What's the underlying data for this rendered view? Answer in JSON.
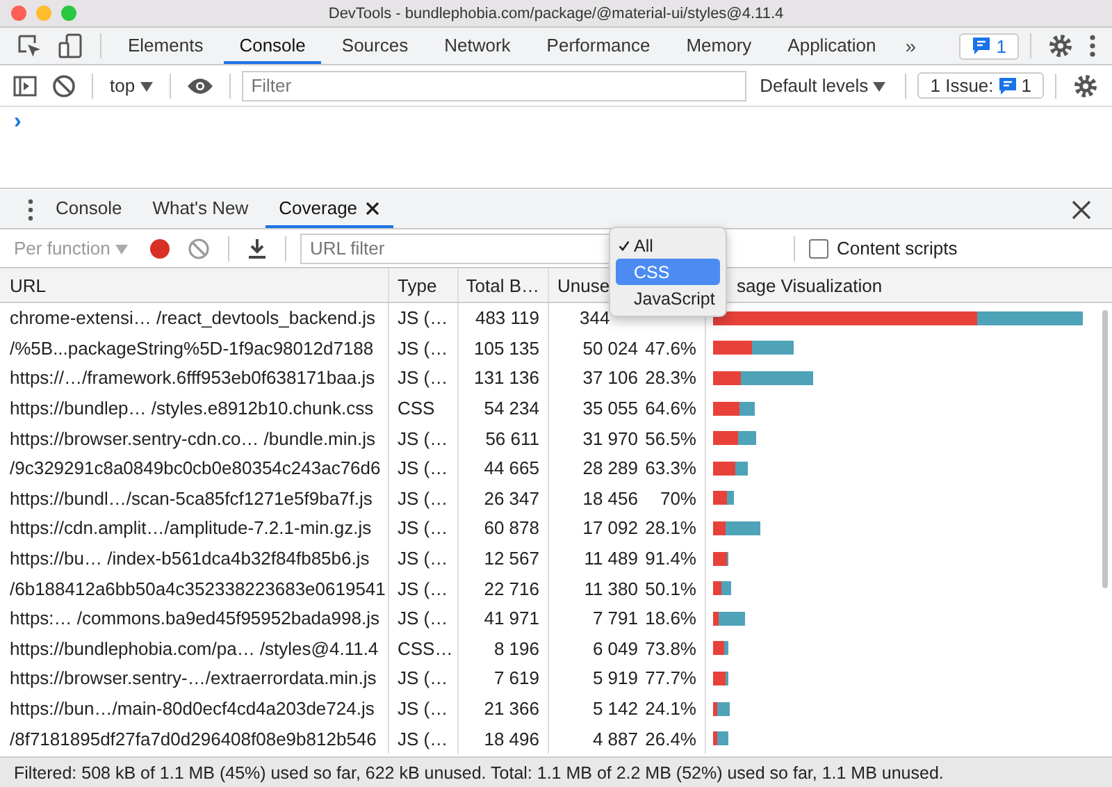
{
  "window": {
    "title": "DevTools - bundlephobia.com/package/@material-ui/styles@4.11.4"
  },
  "main_tabs": [
    {
      "label": "Elements",
      "selected": false
    },
    {
      "label": "Console",
      "selected": true
    },
    {
      "label": "Sources",
      "selected": false
    },
    {
      "label": "Network",
      "selected": false
    },
    {
      "label": "Performance",
      "selected": false
    },
    {
      "label": "Memory",
      "selected": false
    },
    {
      "label": "Application",
      "selected": false
    }
  ],
  "more_tabs": "»",
  "messages_badge": "1",
  "console_toolbar": {
    "context": "top",
    "filter_placeholder": "Filter",
    "levels": "Default levels",
    "issues_label": "1 Issue:",
    "issues_count": "1"
  },
  "prompt": "›",
  "drawer_tabs": [
    {
      "label": "Console",
      "selected": false,
      "closable": false
    },
    {
      "label": "What's New",
      "selected": false,
      "closable": false
    },
    {
      "label": "Coverage",
      "selected": true,
      "closable": true
    }
  ],
  "coverage_toolbar": {
    "mode": "Per function",
    "recording": true,
    "url_filter_placeholder": "URL filter",
    "content_scripts": {
      "label": "Content scripts",
      "checked": false
    }
  },
  "type_menu": [
    {
      "label": "All",
      "checked": true,
      "selected": false
    },
    {
      "label": "CSS",
      "checked": false,
      "selected": true
    },
    {
      "label": "JavaScript",
      "checked": false,
      "selected": false
    }
  ],
  "table": {
    "columns": [
      "URL",
      "Type",
      "Total B…",
      "Unuse",
      "sage Visualization"
    ],
    "rows": [
      {
        "url": "chrome-extensi…  /react_devtools_backend.js",
        "type": "JS (…",
        "total": "483 119",
        "unused": "344",
        "level": 0.713
      },
      {
        "url": "/%5B...packageString%5D-1f9ac98012d7188",
        "type": "JS (…",
        "total": "105 135",
        "unused": "50 024",
        "percent": "47.6%",
        "level": 0.476
      },
      {
        "url": "https://…/framework.6fff953eb0f638171baa.js",
        "type": "JS (…",
        "total": "131 136",
        "unused": "37 106",
        "percent": "28.3%",
        "level": 0.283
      },
      {
        "url": "https://bundlep…  /styles.e8912b10.chunk.css",
        "type": "CSS",
        "total": "54 234",
        "unused": "35 055",
        "percent": "64.6%",
        "level": 0.646
      },
      {
        "url": "https://browser.sentry-cdn.co… /bundle.min.js",
        "type": "JS (…",
        "total": "56 611",
        "unused": "31 970",
        "percent": "56.5%",
        "level": 0.565
      },
      {
        "url": "/9c329291c8a0849bc0cb0e80354c243ac76d6",
        "type": "JS (…",
        "total": "44 665",
        "unused": "28 289",
        "percent": "63.3%",
        "level": 0.633
      },
      {
        "url": "https://bundl…/scan-5ca85fcf1271e5f9ba7f.js",
        "type": "JS (…",
        "total": "26 347",
        "unused": "18 456",
        "percent": "70%",
        "level": 0.7
      },
      {
        "url": "https://cdn.amplit…/amplitude-7.2.1-min.gz.js",
        "type": "JS (…",
        "total": "60 878",
        "unused": "17 092",
        "percent": "28.1%",
        "level": 0.281
      },
      {
        "url": "https://bu…  /index-b561dca4b32f84fb85b6.js",
        "type": "JS (…",
        "total": "12 567",
        "unused": "11 489",
        "percent": "91.4%",
        "level": 0.914
      },
      {
        "url": "/6b188412a6bb50a4c352338223683e0619541",
        "type": "JS (…",
        "total": "22 716",
        "unused": "11 380",
        "percent": "50.1%",
        "level": 0.501
      },
      {
        "url": "https:… /commons.ba9ed45f95952bada998.js",
        "type": "JS (…",
        "total": "41 971",
        "unused": "7 791",
        "percent": "18.6%",
        "level": 0.186
      },
      {
        "url": "https://bundlephobia.com/pa… /styles@4.11.4",
        "type": "CSS…",
        "total": "8 196",
        "unused": "6 049",
        "percent": "73.8%",
        "level": 0.738
      },
      {
        "url": "https://browser.sentry-…/extraerrordata.min.js",
        "type": "JS (…",
        "total": "7 619",
        "unused": "5 919",
        "percent": "77.7%",
        "level": 0.777
      },
      {
        "url": "https://bun…/main-80d0ecf4cd4a203de724.js",
        "type": "JS (…",
        "total": "21 366",
        "unused": "5 142",
        "percent": "24.1%",
        "level": 0.241
      },
      {
        "url": "/8f7181895df27fa7d0d296408f08e9b812b546",
        "type": "JS (…",
        "total": "18 496",
        "unused": "4 887",
        "percent": "26.4%",
        "level": 0.264
      }
    ]
  },
  "status_bar": "Filtered: 508 kB of 1.1 MB (45%) used so far, 622 kB unused. Total: 1.1 MB of 2.2 MB (52%) used so far, 1.1 MB unused."
}
